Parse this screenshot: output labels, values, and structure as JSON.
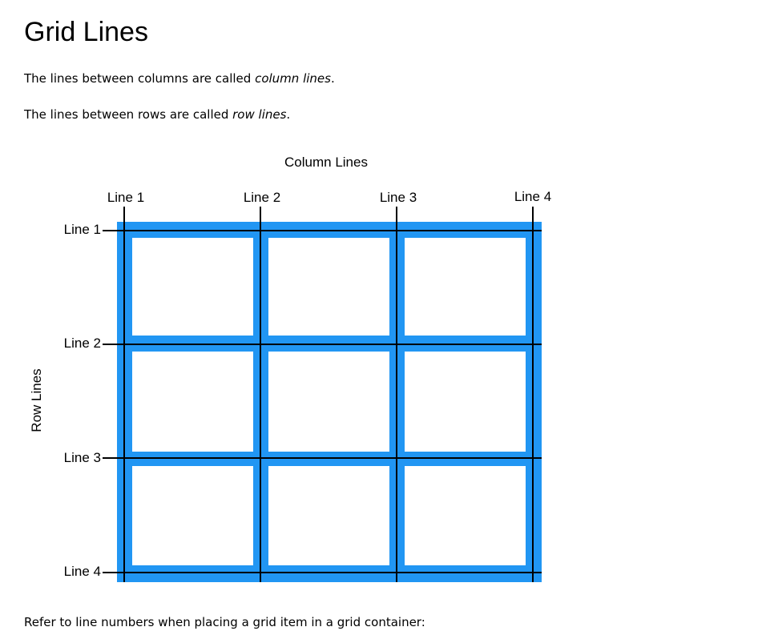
{
  "page": {
    "title": "Grid Lines",
    "paragraphs": [
      {
        "before": "The lines between columns are called ",
        "emphasis": "column lines",
        "after": "."
      },
      {
        "before": "The lines between rows are called ",
        "emphasis": "row lines",
        "after": "."
      }
    ],
    "footer_text": "Refer to line numbers when placing a grid item in a grid container:"
  },
  "figure": {
    "column_heading": "Column Lines",
    "row_heading": "Row Lines",
    "column_line_labels": [
      "Line 1",
      "Line 2",
      "Line 3",
      "Line 4"
    ],
    "row_line_labels": [
      "Line 1",
      "Line 2",
      "Line 3",
      "Line 4"
    ],
    "grid_rows": 3,
    "grid_columns": 3,
    "colors": {
      "grid_border": "#2196f3",
      "cell_fill": "#ffffff",
      "line_stroke": "#000000"
    }
  }
}
